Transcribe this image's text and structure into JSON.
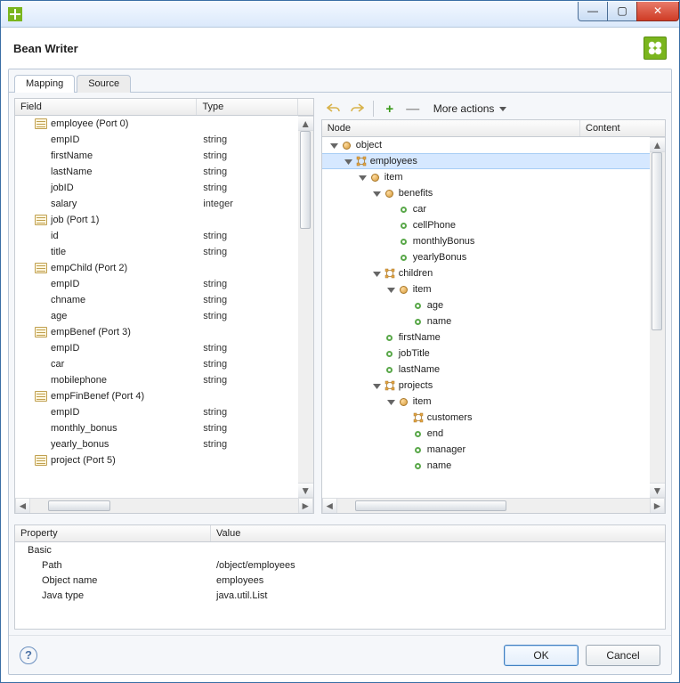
{
  "window": {
    "title": "Bean Writer"
  },
  "tabs": {
    "mapping": "Mapping",
    "source": "Source",
    "active": "mapping"
  },
  "leftGrid": {
    "headers": {
      "field": "Field",
      "type": "Type"
    },
    "rows": [
      {
        "kind": "port",
        "label": "employee (Port 0)"
      },
      {
        "kind": "field",
        "label": "empID",
        "type": "string"
      },
      {
        "kind": "field",
        "label": "firstName",
        "type": "string"
      },
      {
        "kind": "field",
        "label": "lastName",
        "type": "string"
      },
      {
        "kind": "field",
        "label": "jobID",
        "type": "string"
      },
      {
        "kind": "field",
        "label": "salary",
        "type": "integer"
      },
      {
        "kind": "port",
        "label": "job (Port 1)"
      },
      {
        "kind": "field",
        "label": "id",
        "type": "string"
      },
      {
        "kind": "field",
        "label": "title",
        "type": "string"
      },
      {
        "kind": "port",
        "label": "empChild (Port 2)"
      },
      {
        "kind": "field",
        "label": "empID",
        "type": "string"
      },
      {
        "kind": "field",
        "label": "chname",
        "type": "string"
      },
      {
        "kind": "field",
        "label": "age",
        "type": "string"
      },
      {
        "kind": "port",
        "label": "empBenef (Port 3)"
      },
      {
        "kind": "field",
        "label": "empID",
        "type": "string"
      },
      {
        "kind": "field",
        "label": "car",
        "type": "string"
      },
      {
        "kind": "field",
        "label": "mobilephone",
        "type": "string"
      },
      {
        "kind": "port",
        "label": "empFinBenef (Port 4)"
      },
      {
        "kind": "field",
        "label": "empID",
        "type": "string"
      },
      {
        "kind": "field",
        "label": "monthly_bonus",
        "type": "string"
      },
      {
        "kind": "field",
        "label": "yearly_bonus",
        "type": "string"
      },
      {
        "kind": "port",
        "label": "project (Port 5)"
      }
    ]
  },
  "toolbar": {
    "more": "More actions"
  },
  "tree": {
    "headers": {
      "node": "Node",
      "content": "Content"
    },
    "nodes": [
      {
        "depth": 0,
        "expand": "open",
        "icon": "object",
        "label": "object"
      },
      {
        "depth": 1,
        "expand": "open",
        "icon": "list",
        "label": "employees",
        "selected": true
      },
      {
        "depth": 2,
        "expand": "open",
        "icon": "object",
        "label": "item"
      },
      {
        "depth": 3,
        "expand": "open",
        "icon": "object",
        "label": "benefits"
      },
      {
        "depth": 4,
        "expand": "none",
        "icon": "leaf",
        "label": "car"
      },
      {
        "depth": 4,
        "expand": "none",
        "icon": "leaf",
        "label": "cellPhone"
      },
      {
        "depth": 4,
        "expand": "none",
        "icon": "leaf",
        "label": "monthlyBonus"
      },
      {
        "depth": 4,
        "expand": "none",
        "icon": "leaf",
        "label": "yearlyBonus"
      },
      {
        "depth": 3,
        "expand": "open",
        "icon": "list",
        "label": "children"
      },
      {
        "depth": 4,
        "expand": "open",
        "icon": "object",
        "label": "item"
      },
      {
        "depth": 5,
        "expand": "none",
        "icon": "leaf",
        "label": "age"
      },
      {
        "depth": 5,
        "expand": "none",
        "icon": "leaf",
        "label": "name"
      },
      {
        "depth": 3,
        "expand": "none",
        "icon": "leaf",
        "label": "firstName"
      },
      {
        "depth": 3,
        "expand": "none",
        "icon": "leaf",
        "label": "jobTitle"
      },
      {
        "depth": 3,
        "expand": "none",
        "icon": "leaf",
        "label": "lastName"
      },
      {
        "depth": 3,
        "expand": "open",
        "icon": "list",
        "label": "projects"
      },
      {
        "depth": 4,
        "expand": "open",
        "icon": "object",
        "label": "item"
      },
      {
        "depth": 5,
        "expand": "none",
        "icon": "list",
        "label": "customers"
      },
      {
        "depth": 5,
        "expand": "none",
        "icon": "leaf",
        "label": "end"
      },
      {
        "depth": 5,
        "expand": "none",
        "icon": "leaf",
        "label": "manager"
      },
      {
        "depth": 5,
        "expand": "none",
        "icon": "leaf",
        "label": "name"
      }
    ]
  },
  "properties": {
    "headers": {
      "property": "Property",
      "value": "Value"
    },
    "groupLabel": "Basic",
    "rows": [
      {
        "name": "Path",
        "value": "/object/employees"
      },
      {
        "name": "Object name",
        "value": "employees"
      },
      {
        "name": "Java type",
        "value": "java.util.List"
      }
    ]
  },
  "buttons": {
    "ok": "OK",
    "cancel": "Cancel"
  }
}
